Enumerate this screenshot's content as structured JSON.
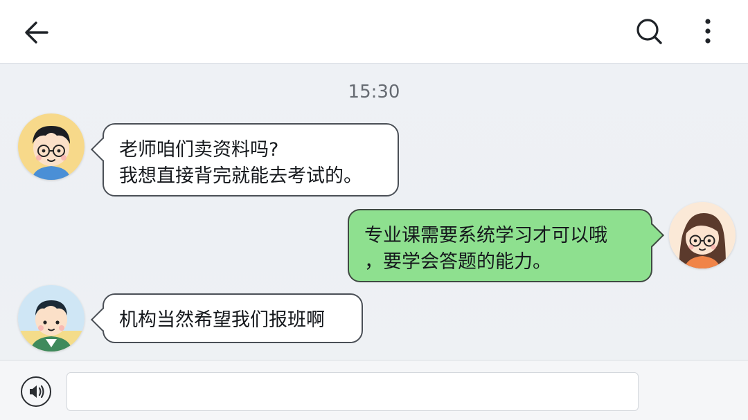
{
  "header": {
    "back_icon": "arrow-left-icon",
    "search_icon": "search-icon",
    "more_icon": "more-vertical-icon"
  },
  "chat": {
    "timestamp": "15:30",
    "messages": [
      {
        "side": "left",
        "avatar": "boy-with-glasses-avatar",
        "lines": [
          "老师咱们卖资料吗?",
          "我想直接背完就能去考试的。"
        ]
      },
      {
        "side": "right",
        "avatar": "woman-with-glasses-avatar",
        "lines": [
          "专业课需要系统学习才可以哦",
          "，要学会答题的能力。"
        ]
      },
      {
        "side": "left",
        "avatar": "boy-avatar",
        "lines": [
          "机构当然希望我们报班啊"
        ]
      }
    ]
  },
  "inputbar": {
    "voice_icon": "voice-icon",
    "input_value": "",
    "input_placeholder": ""
  },
  "colors": {
    "outgoing_bubble": "#8ee08f",
    "incoming_bubble": "#ffffff",
    "chat_background": "#eaeef3"
  }
}
